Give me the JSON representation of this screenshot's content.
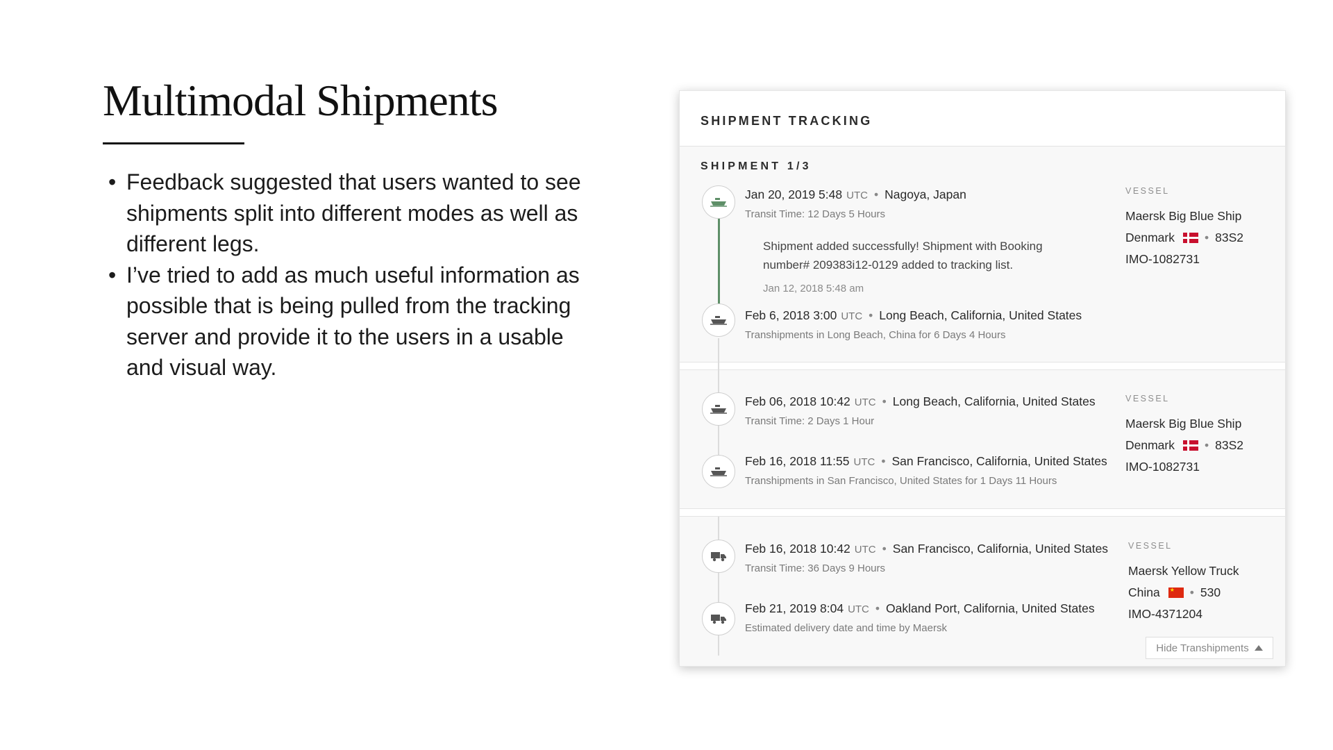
{
  "slide": {
    "title": "Multimodal Shipments",
    "bullets": [
      "Feedback suggested that users wanted to see shipments split into different modes as well as different legs.",
      "I’ve tried to add as much useful information as possible that is being pulled from the tracking server and provide it to the users in a usable and visual way."
    ]
  },
  "card": {
    "title": "SHIPMENT TRACKING",
    "shipment_count": "SHIPMENT 1/3",
    "vessel_label": "VESSEL",
    "hide_button_label": "Hide Transhipments",
    "note": {
      "text": "Shipment added successfully! Shipment with Booking number# 209383i12-0129 added to tracking list.",
      "time": "Jan 12, 2018 5:48 am"
    },
    "legs": [
      {
        "mode_icon": "ship-icon",
        "events": [
          {
            "date": "Jan 20, 2019 5:48",
            "tz": "UTC",
            "location": "Nagoya, Japan",
            "sub": "Transit Time: 12 Days 5 Hours"
          },
          {
            "date": "Feb 6, 2018 3:00",
            "tz": "UTC",
            "location": "Long Beach, California, United States",
            "sub": "Transhipments in Long Beach, China for 6 Days 4 Hours"
          }
        ],
        "vessel": {
          "name": "Maersk Big Blue Ship",
          "country": "Denmark",
          "flag_icon": "denmark-flag-icon",
          "code": "83S2",
          "imo": "IMO-1082731"
        }
      },
      {
        "mode_icon": "ship-icon",
        "events": [
          {
            "date": "Feb 06, 2018 10:42",
            "tz": "UTC",
            "location": "Long Beach, California, United States",
            "sub": "Transit Time: 2 Days 1 Hour"
          },
          {
            "date": "Feb 16, 2018 11:55",
            "tz": "UTC",
            "location": "San Francisco, California, United States",
            "sub": "Transhipments in San Francisco, United States for 1 Days 11 Hours"
          }
        ],
        "vessel": {
          "name": "Maersk Big Blue Ship",
          "country": "Denmark",
          "flag_icon": "denmark-flag-icon",
          "code": "83S2",
          "imo": "IMO-1082731"
        }
      },
      {
        "mode_icon": "truck-icon",
        "events": [
          {
            "date": "Feb 16, 2018 10:42",
            "tz": "UTC",
            "location": "San Francisco, California, United States",
            "sub": "Transit Time: 36 Days 9 Hours"
          },
          {
            "date": "Feb 21, 2019 8:04",
            "tz": "UTC",
            "location": "Oakland Port, California, United States",
            "sub": "Estimated delivery date and time by Maersk"
          }
        ],
        "vessel": {
          "name": "Maersk Yellow Truck",
          "country": "China",
          "flag_icon": "china-flag-icon",
          "code": "530",
          "imo": "IMO-4371204"
        }
      }
    ]
  },
  "colors": {
    "timeline_active": "#5e8f68",
    "card_bg": "#f8f8f8",
    "denmark_flag": "#c8102e",
    "china_flag": "#de2910"
  }
}
